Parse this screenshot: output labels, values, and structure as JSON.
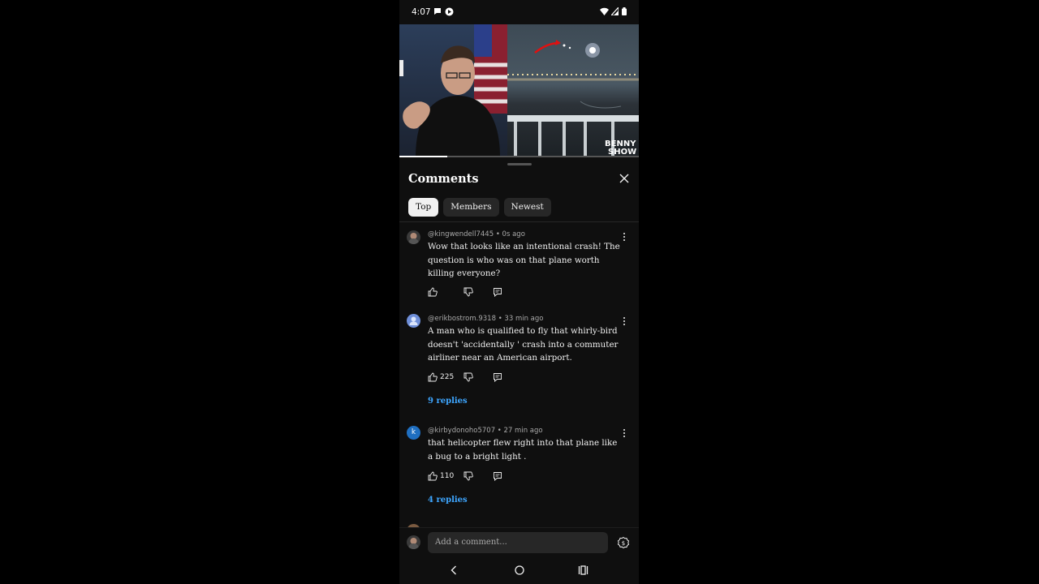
{
  "status_bar": {
    "time": "4:07"
  },
  "panel": {
    "title": "Comments",
    "chips": [
      {
        "label": "Top",
        "active": true
      },
      {
        "label": "Members",
        "active": false
      },
      {
        "label": "Newest",
        "active": false
      }
    ]
  },
  "video": {
    "progress_fraction": 0.2
  },
  "comments": [
    {
      "handle": "@kingwendell7445",
      "time": "0s ago",
      "text": "Wow that looks like an intentional crash! The question is who was on that plane worth killing everyone?",
      "likes": "",
      "replies": ""
    },
    {
      "handle": "@erikbostrom.9318",
      "time": "33 min ago",
      "text": "A man who is qualified to fly that whirly-bird doesn't 'accidentally ' crash into a commuter airliner near an American airport.",
      "likes": "225",
      "replies": "9 replies"
    },
    {
      "handle": "@kirbydonoho5707",
      "time": "27 min ago",
      "text": "that helicopter flew right into that plane like a bug to a bright light .",
      "likes": "110",
      "replies": "4 replies",
      "avatar_letter": "k"
    }
  ],
  "comment_input": {
    "placeholder": "Add a comment..."
  },
  "colors": {
    "accent_link": "#3ea6ff",
    "background": "#0f0f0f",
    "chip_bg": "#272727"
  }
}
